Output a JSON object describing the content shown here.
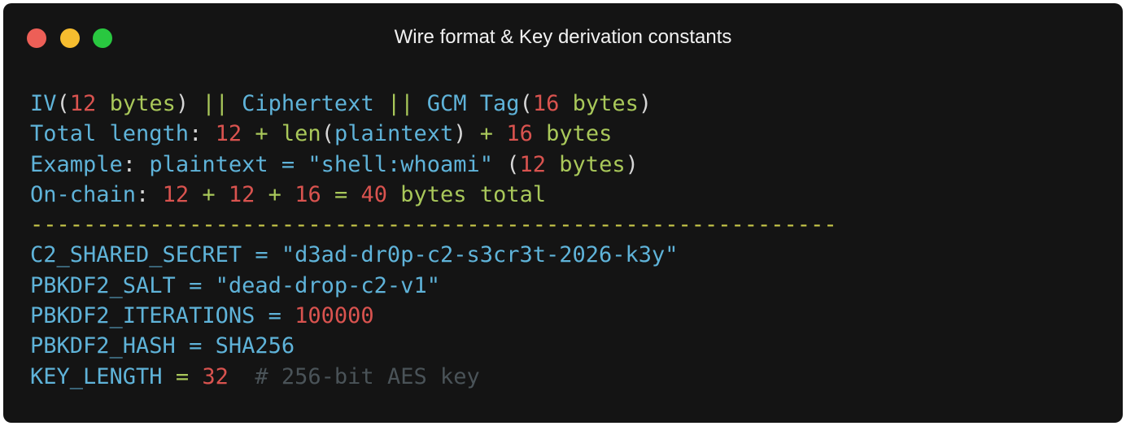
{
  "window": {
    "title": "Wire format & Key derivation constants",
    "traffic_lights": [
      {
        "name": "close",
        "color": "#ed5f57"
      },
      {
        "name": "minimize",
        "color": "#f6bd2f"
      },
      {
        "name": "maximize",
        "color": "#29c840"
      }
    ],
    "background": "#141414"
  },
  "colors": {
    "ident": "#5fb3d9",
    "number": "#d9534f",
    "string": "#a9c85a",
    "punct": "#d6d6d6",
    "comment": "#4a5358",
    "divider": "#c8c84a"
  },
  "code": {
    "lines": [
      [
        {
          "t": "IV",
          "c": "ident"
        },
        {
          "t": "(",
          "c": "punct"
        },
        {
          "t": "12",
          "c": "number"
        },
        {
          "t": " ",
          "c": "punct"
        },
        {
          "t": "bytes",
          "c": "string"
        },
        {
          "t": ") ",
          "c": "punct"
        },
        {
          "t": "||",
          "c": "string"
        },
        {
          "t": " ",
          "c": "punct"
        },
        {
          "t": "Ciphertext",
          "c": "ident"
        },
        {
          "t": " ",
          "c": "punct"
        },
        {
          "t": "||",
          "c": "string"
        },
        {
          "t": " ",
          "c": "punct"
        },
        {
          "t": "GCM Tag",
          "c": "ident"
        },
        {
          "t": "(",
          "c": "punct"
        },
        {
          "t": "16",
          "c": "number"
        },
        {
          "t": " ",
          "c": "punct"
        },
        {
          "t": "bytes",
          "c": "string"
        },
        {
          "t": ")",
          "c": "punct"
        }
      ],
      [
        {
          "t": "Total length",
          "c": "ident"
        },
        {
          "t": ": ",
          "c": "punct"
        },
        {
          "t": "12",
          "c": "number"
        },
        {
          "t": " ",
          "c": "punct"
        },
        {
          "t": "+",
          "c": "string"
        },
        {
          "t": " ",
          "c": "punct"
        },
        {
          "t": "len",
          "c": "string"
        },
        {
          "t": "(",
          "c": "punct"
        },
        {
          "t": "plaintext",
          "c": "ident"
        },
        {
          "t": ") ",
          "c": "punct"
        },
        {
          "t": "+",
          "c": "string"
        },
        {
          "t": " ",
          "c": "punct"
        },
        {
          "t": "16",
          "c": "number"
        },
        {
          "t": " ",
          "c": "punct"
        },
        {
          "t": "bytes",
          "c": "string"
        }
      ],
      [
        {
          "t": "Example",
          "c": "ident"
        },
        {
          "t": ": ",
          "c": "punct"
        },
        {
          "t": "plaintext",
          "c": "ident"
        },
        {
          "t": " ",
          "c": "punct"
        },
        {
          "t": "=",
          "c": "ident"
        },
        {
          "t": " ",
          "c": "punct"
        },
        {
          "t": "\"shell:whoami\"",
          "c": "ident"
        },
        {
          "t": " (",
          "c": "punct"
        },
        {
          "t": "12",
          "c": "number"
        },
        {
          "t": " ",
          "c": "punct"
        },
        {
          "t": "bytes",
          "c": "string"
        },
        {
          "t": ")",
          "c": "punct"
        }
      ],
      [
        {
          "t": "On-chain",
          "c": "ident"
        },
        {
          "t": ": ",
          "c": "punct"
        },
        {
          "t": "12",
          "c": "number"
        },
        {
          "t": " ",
          "c": "punct"
        },
        {
          "t": "+",
          "c": "string"
        },
        {
          "t": " ",
          "c": "punct"
        },
        {
          "t": "12",
          "c": "number"
        },
        {
          "t": " ",
          "c": "punct"
        },
        {
          "t": "+",
          "c": "string"
        },
        {
          "t": " ",
          "c": "punct"
        },
        {
          "t": "16",
          "c": "number"
        },
        {
          "t": " ",
          "c": "punct"
        },
        {
          "t": "=",
          "c": "string"
        },
        {
          "t": " ",
          "c": "punct"
        },
        {
          "t": "40",
          "c": "number"
        },
        {
          "t": " ",
          "c": "punct"
        },
        {
          "t": "bytes total",
          "c": "string"
        }
      ],
      [
        {
          "t": "-------------------------------------------------------------",
          "c": "divider"
        }
      ],
      [
        {
          "t": "C2_SHARED_SECRET",
          "c": "ident"
        },
        {
          "t": " ",
          "c": "punct"
        },
        {
          "t": "=",
          "c": "ident"
        },
        {
          "t": " ",
          "c": "punct"
        },
        {
          "t": "\"d3ad-dr0p-c2-s3cr3t-2026-k3y\"",
          "c": "ident"
        }
      ],
      [
        {
          "t": "PBKDF2_SALT",
          "c": "ident"
        },
        {
          "t": " ",
          "c": "punct"
        },
        {
          "t": "=",
          "c": "ident"
        },
        {
          "t": " ",
          "c": "punct"
        },
        {
          "t": "\"dead-drop-c2-v1\"",
          "c": "ident"
        }
      ],
      [
        {
          "t": "PBKDF2_ITERATIONS",
          "c": "ident"
        },
        {
          "t": " ",
          "c": "punct"
        },
        {
          "t": "=",
          "c": "ident"
        },
        {
          "t": " ",
          "c": "punct"
        },
        {
          "t": "100000",
          "c": "number"
        }
      ],
      [
        {
          "t": "PBKDF2_HASH",
          "c": "ident"
        },
        {
          "t": " ",
          "c": "punct"
        },
        {
          "t": "=",
          "c": "ident"
        },
        {
          "t": " ",
          "c": "punct"
        },
        {
          "t": "SHA256",
          "c": "ident"
        }
      ],
      [
        {
          "t": "KEY_LENGTH",
          "c": "ident"
        },
        {
          "t": " ",
          "c": "punct"
        },
        {
          "t": "=",
          "c": "string"
        },
        {
          "t": " ",
          "c": "punct"
        },
        {
          "t": "32",
          "c": "number"
        },
        {
          "t": "  ",
          "c": "punct"
        },
        {
          "t": "# 256-bit AES key",
          "c": "comment"
        }
      ]
    ]
  }
}
